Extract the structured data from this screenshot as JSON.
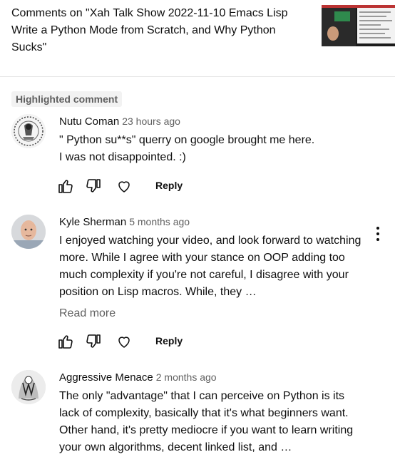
{
  "header": {
    "title": "Comments on \"Xah Talk Show 2022-11-10 Emacs Lisp Write a Python Mode from Scratch, and Why Python Sucks\""
  },
  "highlight_chip": "Highlighted comment",
  "actions": {
    "reply_label": "Reply"
  },
  "comments": [
    {
      "author": "Nutu Coman",
      "time": "23 hours ago",
      "text": "\" Python su**s\" querry on google brought me here.\nI was not disappointed. :)"
    },
    {
      "author": "Kyle Sherman",
      "time": "5 months ago",
      "text": "I enjoyed watching your video, and look forward to watching more. While I agree with your stance on OOP adding too much complexity if you're not careful, I disagree with your position on Lisp macros. While, they …",
      "read_more": "Read more"
    },
    {
      "author": "Aggressive Menace",
      "time": "2 months ago",
      "text": "The only \"advantage\" that I can perceive on Python is its lack of complexity, basically that it's what beginners want. Other hand, it's pretty mediocre if you want to learn writing your own algorithms, decent linked list, and …"
    }
  ],
  "icons": {
    "like": "thumbs-up-icon",
    "dislike": "thumbs-down-icon",
    "heart": "heart-icon",
    "menu": "more-vertical-icon"
  }
}
